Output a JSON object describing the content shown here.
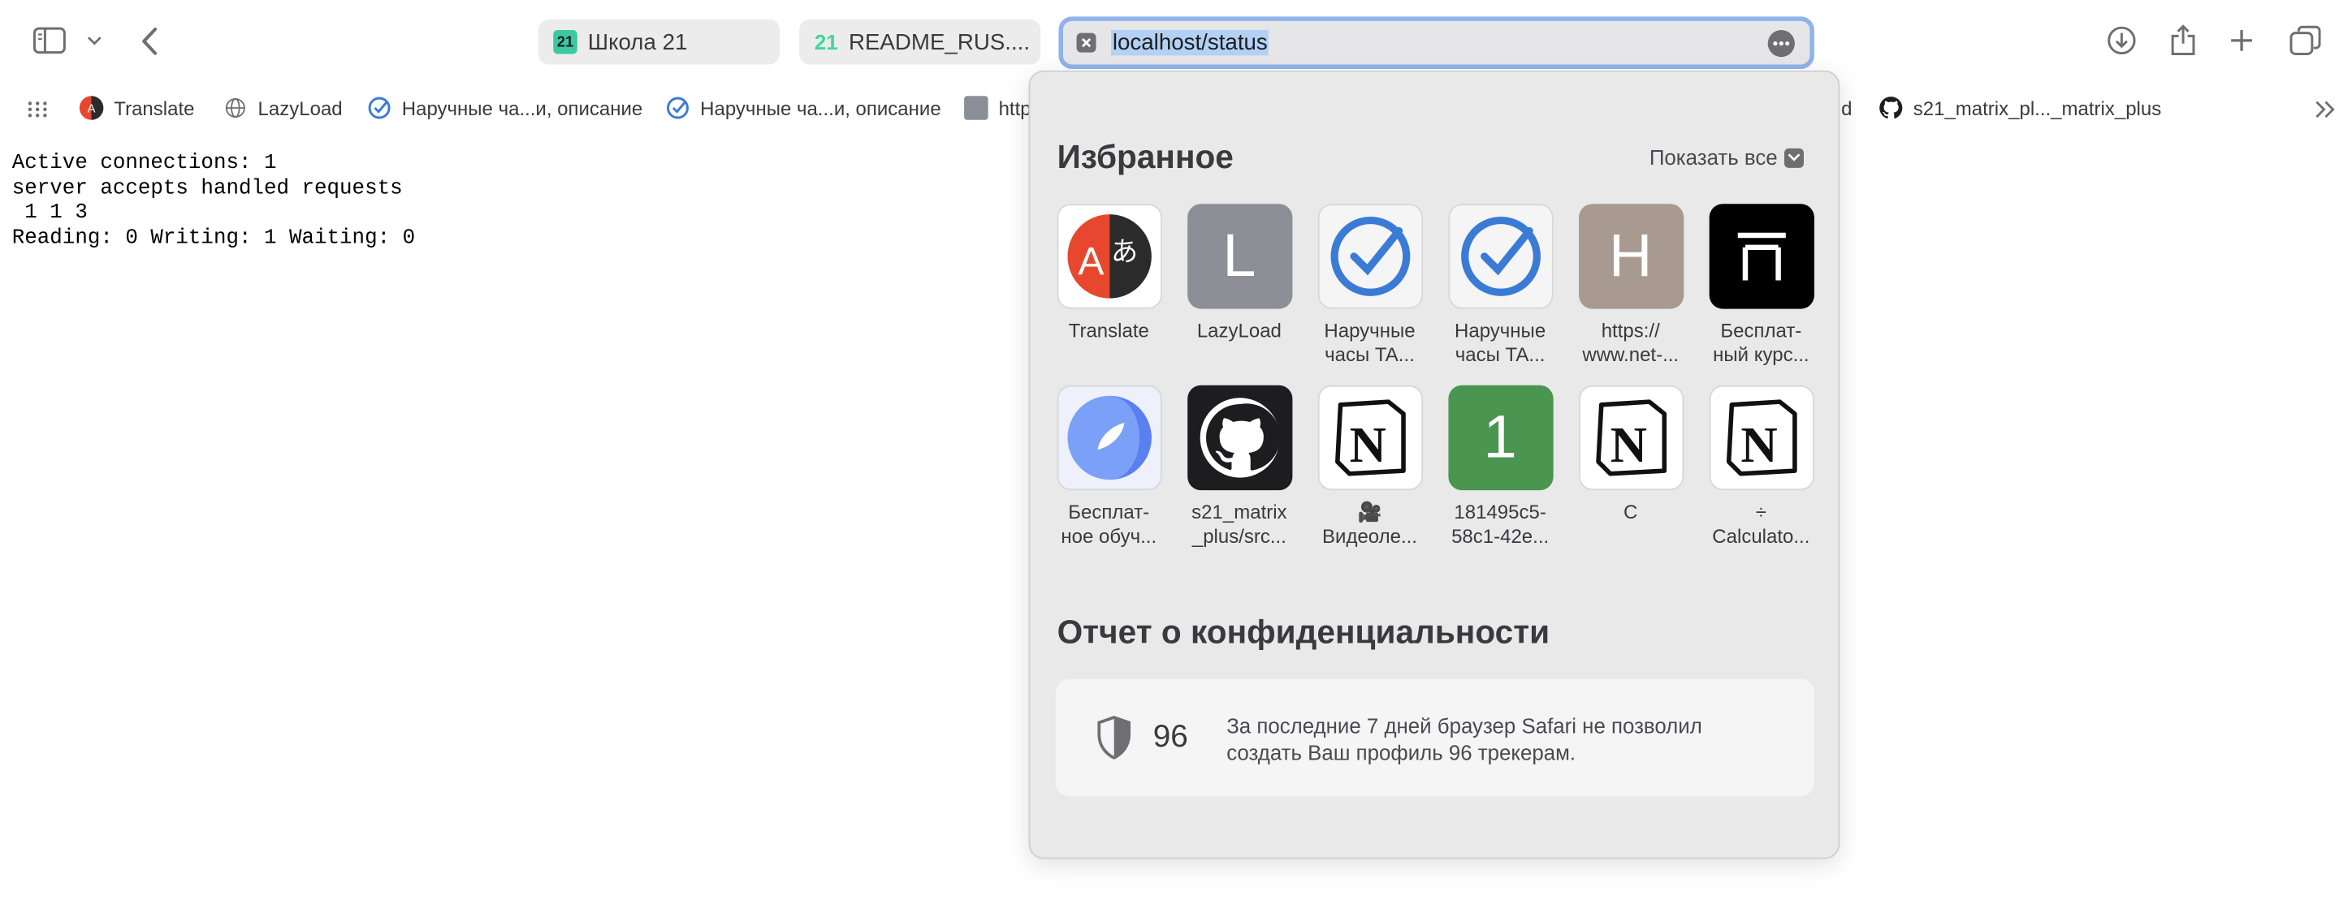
{
  "browser": {
    "tabs": [
      {
        "label": "Школа 21"
      },
      {
        "label": "README_RUS...."
      }
    ],
    "tab_icon_text": "21",
    "address": "localhost/status"
  },
  "bookmarks": [
    {
      "label": "Translate"
    },
    {
      "label": "LazyLoad"
    },
    {
      "label": "Наручные ча...и, описание"
    },
    {
      "label": "Наручные ча...и, описание"
    },
    {
      "label": "http"
    },
    {
      "label": "d"
    },
    {
      "label": "s21_matrix_pl..._matrix_plus"
    }
  ],
  "page": {
    "lines": [
      "Active connections: 1",
      "server accepts handled requests",
      " 1 1 3",
      "Reading: 0 Writing: 1 Waiting: 0"
    ]
  },
  "favorites": {
    "title": "Избранное",
    "show_all": "Показать все",
    "items": [
      {
        "line1": "Translate",
        "line2": ""
      },
      {
        "line1": "LazyLoad",
        "line2": "",
        "letter": "L"
      },
      {
        "line1": "Наручные",
        "line2": "часы TA..."
      },
      {
        "line1": "Наручные",
        "line2": "часы TA..."
      },
      {
        "line1": "https://",
        "line2": "www.net-...",
        "letter": "H"
      },
      {
        "line1": "Бесплат-",
        "line2": "ный курс..."
      },
      {
        "line1": "Бесплат-",
        "line2": "ное обуч..."
      },
      {
        "line1": "s21_matrix",
        "line2": "_plus/src..."
      },
      {
        "line1": "🎥",
        "line2": "Видеоле..."
      },
      {
        "line1": "181495c5-",
        "line2": "58c1-42e...",
        "letter": "1"
      },
      {
        "line1": "C",
        "line2": ""
      },
      {
        "line1": "÷",
        "line2": "Calculato..."
      }
    ]
  },
  "privacy": {
    "title": "Отчет о конфиденциальности",
    "count": "96",
    "text_line1": "За последние 7 дней браузер Safari не позволил",
    "text_line2": "создать Ваш профиль 96 трекерам."
  },
  "colors": {
    "accent_blue": "#3a7bd5",
    "url_focus_ring": "#8fb3ea",
    "lazyload_tile": "#8e8e96",
    "https_tile": "#a89a90",
    "uuid_tile": "#4a9550"
  }
}
